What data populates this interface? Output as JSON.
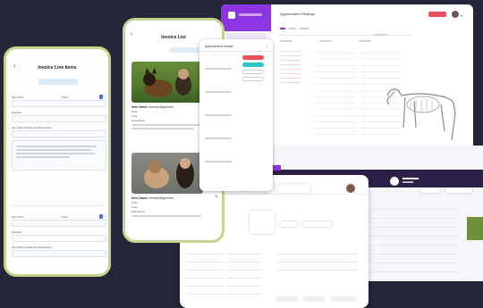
{
  "phone1": {
    "title": "Invoice Line Items",
    "items": [
      {
        "item_price_label": "Item Price",
        "price_label": "Price",
        "quantity_label": "Quantity",
        "description_label": "Item Name/Treatment/Description"
      },
      {
        "item_price_label": "Item Price",
        "price_label": "Price",
        "quantity_label": "Quantity",
        "description_label": "Item Name/Treatment/Description"
      }
    ]
  },
  "phone2": {
    "title": "Invoice List",
    "invoices": [
      {
        "item_name_label": "Item Name:",
        "item_name": "Animal Alignment",
        "price_label": "Price:",
        "cost_label": "Cost:",
        "description_label": "Description:"
      },
      {
        "item_name_label": "Item Name:",
        "item_name": "Animal Alignment",
        "price_label": "Price:",
        "cost_label": "Cost:",
        "description_label": "Description:"
      }
    ]
  },
  "appointment_panel": {
    "title": "Appointment Details"
  },
  "desktop_main": {
    "title": "Appointment Findings"
  },
  "colors": {
    "background": "#24263a",
    "accent_purple": "#8d35e3",
    "frame_green": "#c5d48a",
    "button_red": "#e9505a",
    "button_teal": "#2ec4c4"
  }
}
